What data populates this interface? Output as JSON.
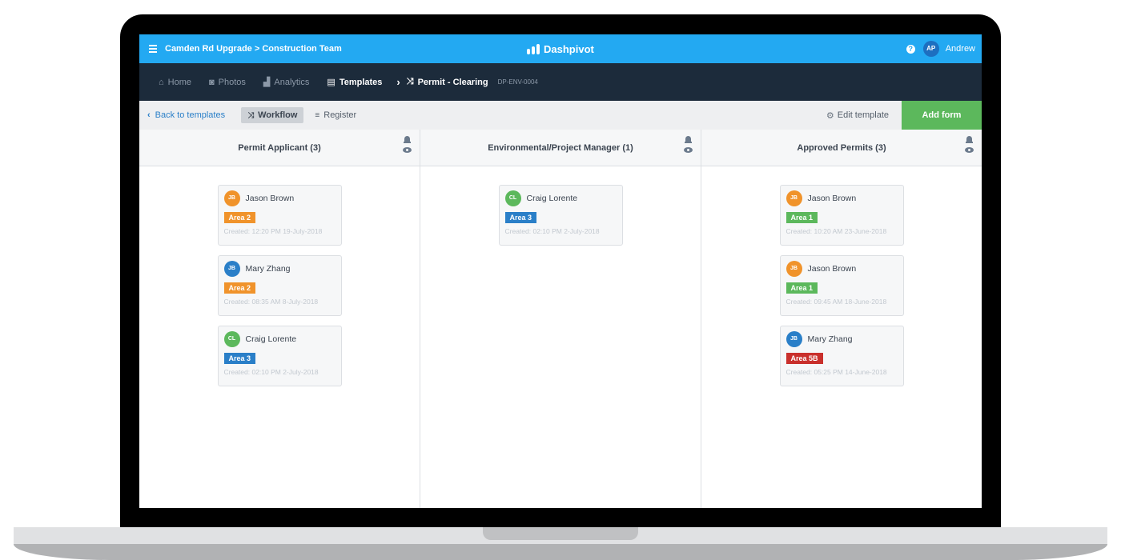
{
  "topbar": {
    "breadcrumb": "Camden Rd Upgrade > Construction Team",
    "brand": "Dashpivot",
    "help_icon": "?",
    "user_initials": "AP",
    "user_name": "Andrew"
  },
  "nav": {
    "items": [
      {
        "label": "Home",
        "icon": "home-icon",
        "glyph": "⌂"
      },
      {
        "label": "Photos",
        "icon": "camera-icon",
        "glyph": "◙"
      },
      {
        "label": "Analytics",
        "icon": "chart-icon",
        "glyph": "▟"
      },
      {
        "label": "Templates",
        "icon": "file-icon",
        "glyph": "▤"
      }
    ],
    "separator": "›",
    "current": {
      "label": "Permit - Clearing",
      "icon": "shuffle-icon",
      "glyph": "⤨"
    },
    "code": "DP-ENV-0004"
  },
  "toolbar": {
    "back_label": "Back to templates",
    "back_glyph": "‹",
    "workflow_label": "Workflow",
    "workflow_glyph": "⤨",
    "register_label": "Register",
    "register_glyph": "≡",
    "edit_template_label": "Edit template",
    "edit_glyph": "⚙",
    "add_form_label": "Add form"
  },
  "colors": {
    "topbar": "#23a9f2",
    "navbar": "#1c2b3b",
    "add_form": "#5cb85c",
    "avatar_orange": "#f0932b",
    "avatar_blue": "#2a7fc8",
    "avatar_green": "#5cb85c",
    "tag_orange": "#f0932b",
    "tag_blue": "#2a7fc8",
    "tag_green": "#5cb85c",
    "tag_red": "#c9302c"
  },
  "columns": [
    {
      "title": "Permit Applicant (3)",
      "cards": [
        {
          "initials": "JB",
          "name": "Jason Brown",
          "avatar_color": "#f0932b",
          "tag": "Area 2",
          "tag_color": "#f0932b",
          "created": "Created: 12:20 PM 19-July-2018"
        },
        {
          "initials": "JB",
          "name": "Mary Zhang",
          "avatar_color": "#2a7fc8",
          "tag": "Area 2",
          "tag_color": "#f0932b",
          "created": "Created: 08:35 AM 8-July-2018"
        },
        {
          "initials": "CL",
          "name": "Craig Lorente",
          "avatar_color": "#5cb85c",
          "tag": "Area 3",
          "tag_color": "#2a7fc8",
          "created": "Created: 02:10 PM 2-July-2018"
        }
      ]
    },
    {
      "title": "Environmental/Project Manager (1)",
      "cards": [
        {
          "initials": "CL",
          "name": "Craig Lorente",
          "avatar_color": "#5cb85c",
          "tag": "Area 3",
          "tag_color": "#2a7fc8",
          "created": "Created: 02:10 PM 2-July-2018"
        }
      ]
    },
    {
      "title": "Approved Permits (3)",
      "cards": [
        {
          "initials": "JB",
          "name": "Jason Brown",
          "avatar_color": "#f0932b",
          "tag": "Area 1",
          "tag_color": "#5cb85c",
          "created": "Created: 10:20 AM 23-June-2018"
        },
        {
          "initials": "JB",
          "name": "Jason Brown",
          "avatar_color": "#f0932b",
          "tag": "Area 1",
          "tag_color": "#5cb85c",
          "created": "Created: 09:45 AM 18-June-2018"
        },
        {
          "initials": "JB",
          "name": "Mary Zhang",
          "avatar_color": "#2a7fc8",
          "tag": "Area 5B",
          "tag_color": "#c9302c",
          "created": "Created: 05:25 PM 14-June-2018"
        }
      ]
    }
  ]
}
